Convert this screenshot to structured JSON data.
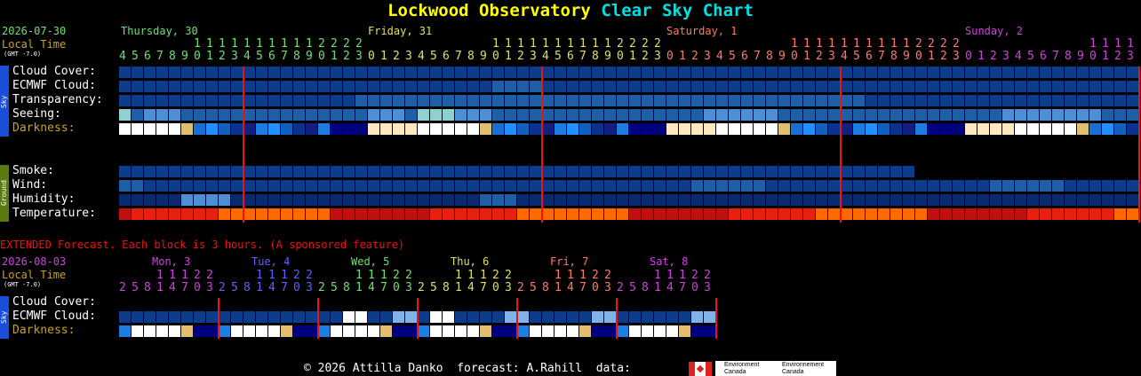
{
  "title": {
    "part1": "Lockwood Observatory",
    "part2": "Clear Sky Chart"
  },
  "colors": {
    "title1": "#ffff00",
    "title2": "#00e0e0",
    "date": "#6fe06f",
    "localtime": "#c8a32a",
    "red": "#e11",
    "day1": "#6fe06f",
    "day2": "#e0e060",
    "day3": "#ff7a6a",
    "day4": "#d040e0"
  },
  "main": {
    "date": "2026-07-30",
    "local_time": "Local Time",
    "gmt": "(GMT -7.0)",
    "days": [
      {
        "label": "Thursday, 30"
      },
      {
        "label": "Friday, 31"
      },
      {
        "label": "Saturday, 1"
      },
      {
        "label": "Sunday, 2"
      }
    ],
    "sky_rows": [
      "Cloud Cover:",
      "ECMWF Cloud:",
      "Transparency:",
      "Seeing:",
      "Darkness:"
    ],
    "ground_rows": [
      "Smoke:",
      "Wind:",
      "Humidity:",
      "Temperature:"
    ],
    "sky_label": "Sky",
    "ground_label": "Ground"
  },
  "extended": {
    "heading": "EXTENDED Forecast. Each block is 3 hours. (A sponsored feature)",
    "date": "2026-08-03",
    "local_time": "Local Time",
    "gmt": "(GMT -7.0)",
    "days": [
      {
        "label": "Mon, 3"
      },
      {
        "label": "Tue, 4"
      },
      {
        "label": "Wed, 5"
      },
      {
        "label": "Thu, 6"
      },
      {
        "label": "Fri, 7"
      },
      {
        "label": "Sat, 8"
      }
    ],
    "rows": [
      "Cloud Cover:",
      "ECMWF Cloud:",
      "Darkness:"
    ],
    "sky_label": "Sky"
  },
  "footer": {
    "text": "© 2026 Attilla Danko  forecast: A.Rahill  data:",
    "logo1": "Environment Canada",
    "logo2": "Environnement Canada"
  }
}
